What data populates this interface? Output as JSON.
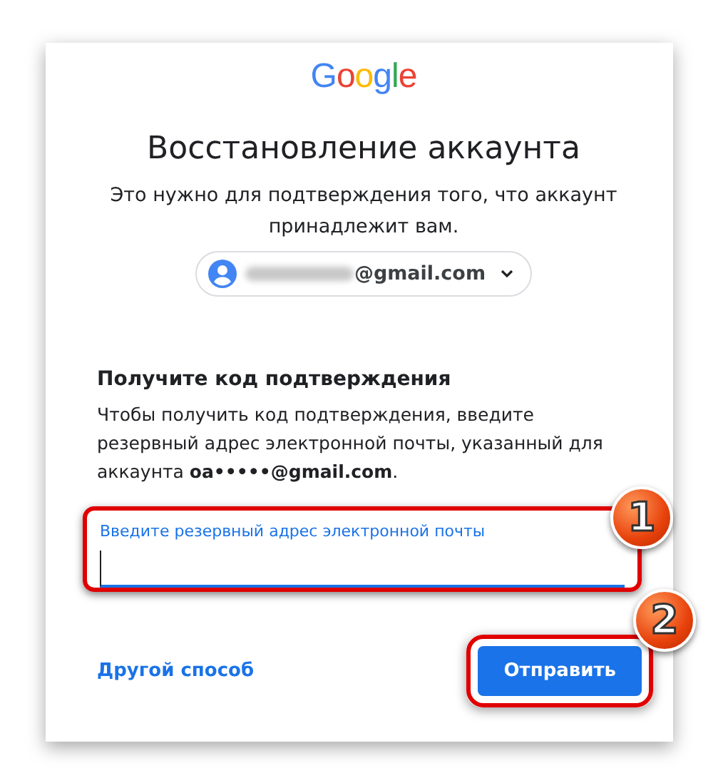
{
  "logo": "Google",
  "title": "Восстановление аккаунта",
  "subtitle": "Это нужно для подтверждения того, что аккаунт принадлежит вам.",
  "account": {
    "email": "@gmail.com",
    "redacted": true
  },
  "section": {
    "heading": "Получите код подтверждения",
    "text": "Чтобы получить код подтверждения, введите резервный адрес электронной почты, указанный для аккаунта **oa•••••@gmail.com**."
  },
  "field": {
    "label": "Введите резервный адрес электронной почты",
    "focused": true,
    "annotation": "1"
  },
  "other_link": "Другой способ",
  "submit": {
    "label": "Отправить",
    "annotation": "2"
  }
}
